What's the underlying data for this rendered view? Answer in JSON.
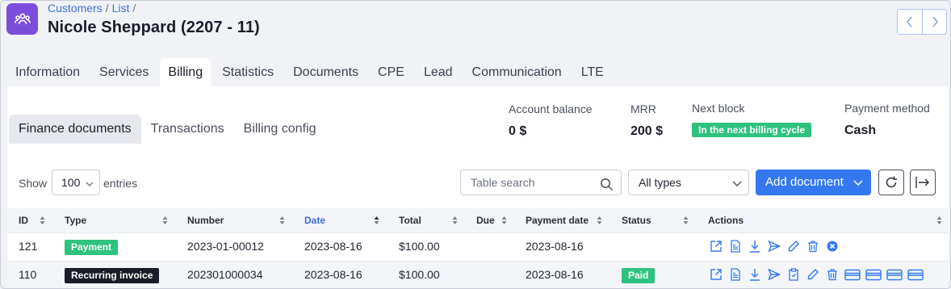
{
  "breadcrumb": [
    "Customers",
    "List"
  ],
  "title": "Nicole Sheppard (2207 - 11)",
  "top_tabs": [
    "Information",
    "Services",
    "Billing",
    "Statistics",
    "Documents",
    "CPE",
    "Lead",
    "Communication",
    "LTE"
  ],
  "active_top_tab": "Billing",
  "sub_tabs": [
    "Finance documents",
    "Transactions",
    "Billing config"
  ],
  "active_sub_tab": "Finance documents",
  "summary": {
    "account_balance_label": "Account balance",
    "account_balance": "0 $",
    "mrr_label": "MRR",
    "mrr": "200 $",
    "next_block_label": "Next block",
    "next_block": "In the next billing cycle",
    "payment_method_label": "Payment method",
    "payment_method": "Cash"
  },
  "controls": {
    "show_label": "Show",
    "entries_value": "100",
    "entries_label": "entries",
    "search_placeholder": "Table search",
    "types_value": "All types",
    "add_document": "Add document"
  },
  "columns": [
    "ID",
    "Type",
    "Number",
    "Date",
    "Total",
    "Due",
    "Payment date",
    "Status",
    "Actions"
  ],
  "sorted_column": "Date",
  "rows": [
    {
      "id": "121",
      "type": "Payment",
      "type_color": "#2ec27e",
      "number": "2023-01-00012",
      "date": "2023-08-16",
      "total": "$100.00",
      "due": "",
      "payment_date": "2023-08-16",
      "status": "",
      "actions": [
        "open-icon",
        "pdf-icon",
        "download-icon",
        "send-icon",
        "edit-icon",
        "delete-icon",
        "cancel-icon"
      ]
    },
    {
      "id": "110",
      "type": "Recurring invoice",
      "type_color": "#1a1d29",
      "number": "202301000034",
      "date": "2023-08-16",
      "total": "$100.00",
      "due": "",
      "payment_date": "2023-08-16",
      "status": "Paid",
      "status_color": "#2ec27e",
      "actions": [
        "open-icon",
        "pdf-icon",
        "download-icon",
        "send-icon",
        "clipboard-icon",
        "edit-icon",
        "delete-icon",
        "card-icon",
        "card-icon",
        "card-icon",
        "card-icon"
      ]
    }
  ],
  "colors": {
    "accent": "#3478f0",
    "brand": "#7c4ddb",
    "success": "#2ec27e"
  }
}
